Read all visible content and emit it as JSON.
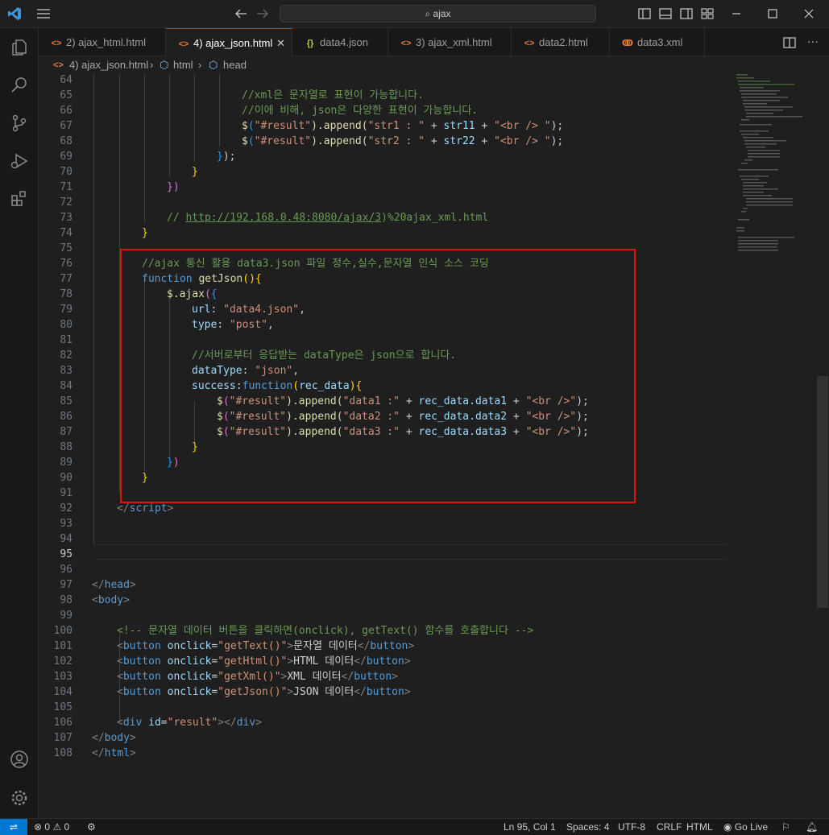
{
  "search": {
    "label": "ajax"
  },
  "tabs": [
    {
      "label": "2) ajax_html.html",
      "icon": "html-icon"
    },
    {
      "label": "4) ajax_json.html",
      "icon": "html-icon",
      "active": true
    },
    {
      "label": "data4.json",
      "icon": "json-icon"
    },
    {
      "label": "3) ajax_xml.html",
      "icon": "html-icon"
    },
    {
      "label": "data2.html",
      "icon": "html-icon"
    },
    {
      "label": "data3.xml",
      "icon": "rss-icon"
    }
  ],
  "breadcrumb": {
    "file": "4) ajax_json.html",
    "item1": "html",
    "item2": "head"
  },
  "lines": [
    {
      "n": "64"
    },
    {
      "n": "65"
    },
    {
      "n": "66"
    },
    {
      "n": "67"
    },
    {
      "n": "68"
    },
    {
      "n": "69"
    },
    {
      "n": "70"
    },
    {
      "n": "71"
    },
    {
      "n": "72"
    },
    {
      "n": "73"
    },
    {
      "n": "74"
    },
    {
      "n": "75"
    },
    {
      "n": "76"
    },
    {
      "n": "77"
    },
    {
      "n": "78"
    },
    {
      "n": "79"
    },
    {
      "n": "80"
    },
    {
      "n": "81"
    },
    {
      "n": "82"
    },
    {
      "n": "83"
    },
    {
      "n": "84"
    },
    {
      "n": "85"
    },
    {
      "n": "86"
    },
    {
      "n": "87"
    },
    {
      "n": "88"
    },
    {
      "n": "89"
    },
    {
      "n": "90"
    },
    {
      "n": "91"
    },
    {
      "n": "92"
    },
    {
      "n": "93"
    },
    {
      "n": "94"
    },
    {
      "n": "95"
    },
    {
      "n": "96"
    },
    {
      "n": "97"
    },
    {
      "n": "98"
    },
    {
      "n": "99"
    },
    {
      "n": "100"
    },
    {
      "n": "101"
    },
    {
      "n": "102"
    },
    {
      "n": "103"
    },
    {
      "n": "104"
    },
    {
      "n": "105"
    },
    {
      "n": "106"
    },
    {
      "n": "107"
    },
    {
      "n": "108"
    }
  ],
  "code": {
    "l65": "//xml은 문자열로 표현이 가능합니다.",
    "l66": "//이에 비해, json은 다양한 표현이 가능합니다.",
    "l67a": "$",
    "l67b": "(",
    "l67c": "\"#result\"",
    "l67d": ").append(",
    "l67e": "\"str1 : \"",
    "l67f": " + ",
    "l67g": "str11",
    "l67h": " + ",
    "l67i": "\"<br /> \"",
    "l67j": ");",
    "l68a": "$",
    "l68b": "(",
    "l68c": "\"#result\"",
    "l68d": ").append(",
    "l68e": "\"str2 : \"",
    "l68f": " + ",
    "l68g": "str22",
    "l68h": " + ",
    "l68i": "\"<br /> \"",
    "l68j": ");",
    "l69a": "}",
    "l69b": ");",
    "l70": "}",
    "l71a": "}",
    "l71b": ")",
    "l73a": "// ",
    "l73b": "http://192.168.0.48:8080/ajax/3",
    "l73c": ")%20ajax_xml.html",
    "l74": "}",
    "l76": "//ajax 통신 활용 data3.json 파일 정수,실수,문자열 인식 소스 코딩",
    "l77a": "function ",
    "l77b": "getJson",
    "l77c": "()",
    "l77d": "{",
    "l78a": "$",
    "l78b": ".ajax",
    "l78c": "(",
    "l78d": "{",
    "l79a": "url",
    "l79b": ": ",
    "l79c": "\"data4.json\"",
    "l79d": ",",
    "l80a": "type",
    "l80b": ": ",
    "l80c": "\"post\"",
    "l80d": ",",
    "l82": "//서버로부터 응답받는 dataType은 json으로 합니다.",
    "l83a": "dataType",
    "l83b": ": ",
    "l83c": "\"json\"",
    "l83d": ",",
    "l84a": "success",
    "l84b": ":",
    "l84c": "function",
    "l84d": "(",
    "l84e": "rec_data",
    "l84f": ")",
    "l84g": "{",
    "l85a": "$",
    "l85b": "(",
    "l85c": "\"#result\"",
    "l85d": ").append(",
    "l85e": "\"data1 :\"",
    "l85f": " + ",
    "l85g": "rec_data.data1",
    "l85h": " + ",
    "l85i": "\"<br />\"",
    "l85j": ");",
    "l86a": "$",
    "l86b": "(",
    "l86c": "\"#result\"",
    "l86d": ").append(",
    "l86e": "\"data2 :\"",
    "l86f": " + ",
    "l86g": "rec_data.data2",
    "l86h": " + ",
    "l86i": "\"<br />\"",
    "l86j": ");",
    "l87a": "$",
    "l87b": "(",
    "l87c": "\"#result\"",
    "l87d": ").append(",
    "l87e": "\"data3 :\"",
    "l87f": " + ",
    "l87g": "rec_data.data3",
    "l87h": " + ",
    "l87i": "\"<br />\"",
    "l87j": ");",
    "l88": "}",
    "l89a": "}",
    "l89b": ")",
    "l90": "}",
    "l92a": "</",
    "l92b": "script",
    "l92c": ">",
    "l97a": "</",
    "l97b": "head",
    "l97c": ">",
    "l98a": "<",
    "l98b": "body",
    "l98c": ">",
    "l100": "<!-- 문자열 데이터 버튼을 클릭하면(onclick), getText() 함수를 호출합니다 -->",
    "l101a": "<",
    "l101b": "button",
    "l101c": " onclick",
    "l101d": "=",
    "l101e": "\"getText()\"",
    "l101f": ">",
    "l101g": "문자열 데이터",
    "l101h": "</",
    "l101i": "button",
    "l101j": ">",
    "l102a": "<",
    "l102b": "button",
    "l102c": " onclick",
    "l102d": "=",
    "l102e": "\"getHtml()\"",
    "l102f": ">",
    "l102g": "HTML 데이터",
    "l102h": "</",
    "l102i": "button",
    "l102j": ">",
    "l103a": "<",
    "l103b": "button",
    "l103c": " onclick",
    "l103d": "=",
    "l103e": "\"getXml()\"",
    "l103f": ">",
    "l103g": "XML 데이터",
    "l103h": "</",
    "l103i": "button",
    "l103j": ">",
    "l104a": "<",
    "l104b": "button",
    "l104c": " onclick",
    "l104d": "=",
    "l104e": "\"getJson()\"",
    "l104f": ">",
    "l104g": "JSON 데이터",
    "l104h": "</",
    "l104i": "button",
    "l104j": ">",
    "l106a": "<",
    "l106b": "div",
    "l106c": " id",
    "l106d": "=",
    "l106e": "\"result\"",
    "l106f": "></",
    "l106g": "div",
    "l106h": ">",
    "l107a": "</",
    "l107b": "body",
    "l107c": ">",
    "l108a": "</",
    "l108b": "html",
    "l108c": ">"
  },
  "status": {
    "errors": "0",
    "warnings": "0",
    "position": "Ln 95, Col 1",
    "spaces": "Spaces: 4",
    "encoding": "UTF-8",
    "eol": "CRLF",
    "language": "HTML",
    "golive": "Go Live"
  },
  "colors": {
    "accent": "#0078d4",
    "highlight_box": "#e01010",
    "statusbar": "#181818"
  }
}
